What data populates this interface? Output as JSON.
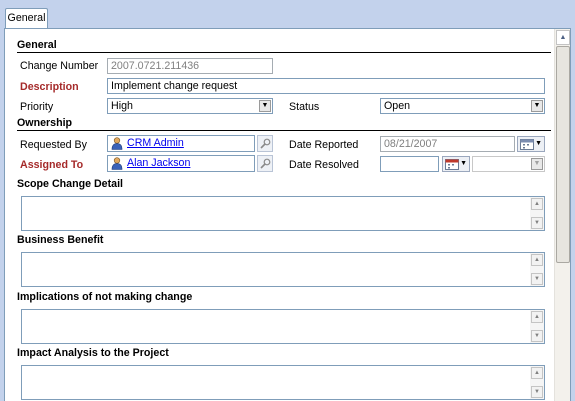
{
  "tabs": [
    {
      "label": "General"
    }
  ],
  "sections": {
    "general": "General",
    "ownership": "Ownership",
    "scope": "Scope Change Detail",
    "benefit": "Business Benefit",
    "implications": "Implications of not making change",
    "impact": "Impact Analysis to the Project"
  },
  "fields": {
    "change_number": {
      "label": "Change Number",
      "value": "2007.0721.211436"
    },
    "description": {
      "label": "Description",
      "value": "Implement change request"
    },
    "priority": {
      "label": "Priority",
      "value": "High"
    },
    "status": {
      "label": "Status",
      "value": "Open"
    },
    "requested_by": {
      "label": "Requested By",
      "value": "CRM Admin"
    },
    "date_reported": {
      "label": "Date Reported",
      "value": "08/21/2007"
    },
    "assigned_to": {
      "label": "Assigned To",
      "value": "Alan Jackson"
    },
    "date_resolved": {
      "label": "Date Resolved",
      "value": ""
    }
  },
  "icons": {
    "user": "user-icon",
    "lookup": "lookup-icon",
    "calendar": "calendar-icon",
    "dropdown": "chevron-down-icon"
  },
  "colors": {
    "required_label": "#a52a2a",
    "link": "#0000ee",
    "tab_background": "#c3d2ec",
    "field_border": "#7f9db9"
  }
}
